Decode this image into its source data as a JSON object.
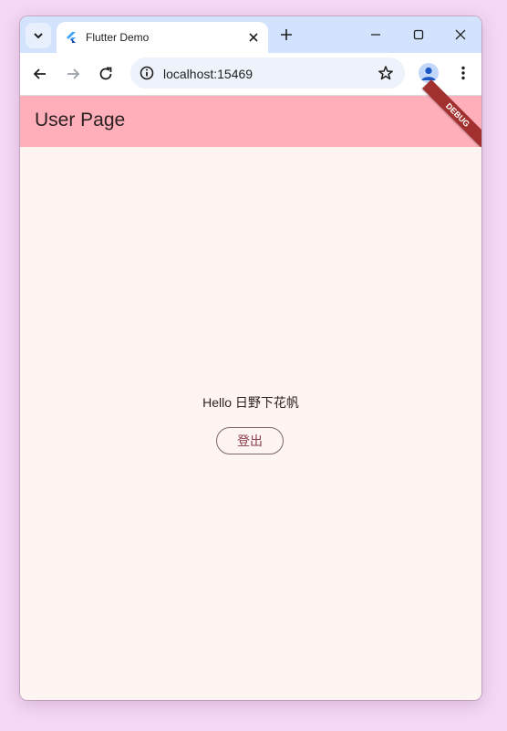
{
  "browser": {
    "tab_title": "Flutter Demo",
    "url": "localhost:15469"
  },
  "app": {
    "appbar_title": "User Page",
    "debug_banner": "DEBUG",
    "greeting": "Hello 日野下花帆",
    "logout_label": "登出"
  },
  "colors": {
    "appbar": "#ffafb9",
    "body_background": "#fef5f3",
    "debug_banner": "#a2302e",
    "tabstrip": "#d3e3fd"
  },
  "icons": {
    "tab_search": "chevron-down-icon",
    "favicon": "flutter-logo-icon",
    "tab_close": "close-icon",
    "new_tab": "plus-icon",
    "minimize": "minimize-icon",
    "maximize": "maximize-icon",
    "window_close": "close-icon",
    "back": "arrow-left-icon",
    "forward": "arrow-right-icon",
    "reload": "reload-icon",
    "site_info": "info-icon",
    "bookmark": "star-icon",
    "profile": "account-icon",
    "menu": "more-vert-icon"
  }
}
